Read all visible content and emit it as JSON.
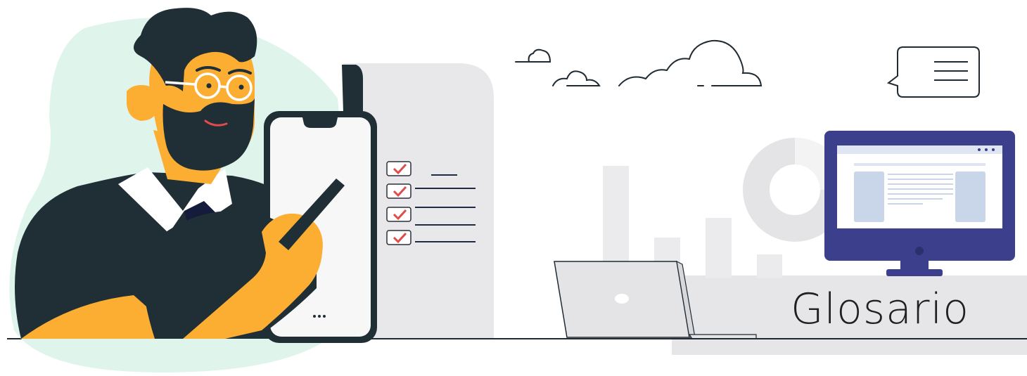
{
  "header": {
    "title": "Glosario"
  },
  "scene": {
    "icons": [
      "person-with-phone-illustration",
      "checklist-document-icon",
      "cloud-icon",
      "chat-bubble-menu-icon",
      "monitor-icon",
      "donut-chart-icon",
      "bar-chart-icon",
      "laptop-icon"
    ],
    "colors": {
      "accent": "#FBAE32",
      "dark": "#202E36",
      "mint": "#DDF3EA",
      "monitor": "#3B3F8C",
      "check": "#E04B4B",
      "gray_panel": "#E6E6E8"
    }
  }
}
